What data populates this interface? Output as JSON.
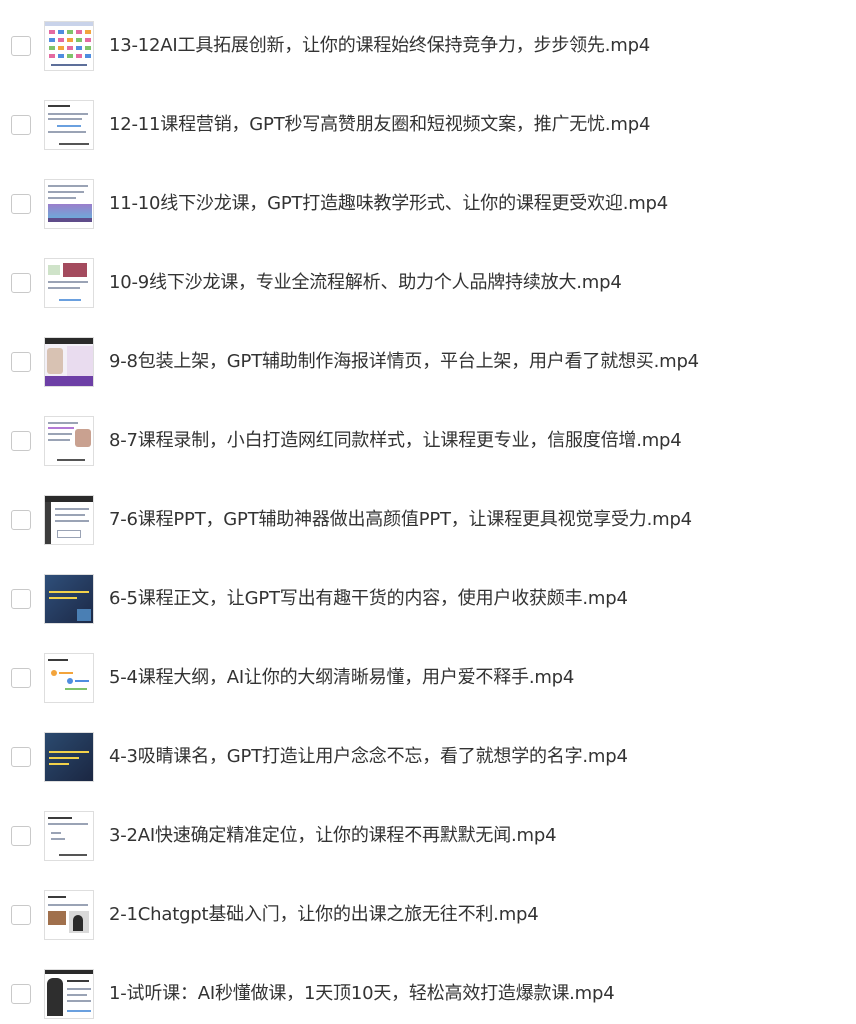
{
  "files": [
    {
      "name": "13-12AI工具拓展创新，让你的课程始终保持竞争力，步步领先.mp4",
      "thumb": "grid-icon-thumbnail"
    },
    {
      "name": "12-11课程营销，GPT秒写高赞朋友圈和短视频文案，推广无忧.mp4",
      "thumb": "doc-thumbnail"
    },
    {
      "name": "11-10线下沙龙课，GPT打造趣味教学形式、让你的课程更受欢迎.mp4",
      "thumb": "doc-photo-thumbnail"
    },
    {
      "name": "10-9线下沙龙课，专业全流程解析、助力个人品牌持续放大.mp4",
      "thumb": "doc-photo-thumbnail"
    },
    {
      "name": "9-8包装上架，GPT辅助制作海报详情页，平台上架，用户看了就想买.mp4",
      "thumb": "presenter-thumbnail"
    },
    {
      "name": "8-7课程录制，小白打造网红同款样式，让课程更专业，信服度倍增.mp4",
      "thumb": "screen-thumbnail"
    },
    {
      "name": "7-6课程PPT，GPT辅助神器做出高颜值PPT，让课程更具视觉享受力.mp4",
      "thumb": "screen-thumbnail"
    },
    {
      "name": "6-5课程正文，让GPT写出有趣干货的内容，使用户收获颇丰.mp4",
      "thumb": "dark-slide-thumbnail"
    },
    {
      "name": "5-4课程大纲，AI让你的大纲清晰易懂，用户爱不释手.mp4",
      "thumb": "mindmap-thumbnail"
    },
    {
      "name": "4-3吸睛课名，GPT打造让用户念念不忘，看了就想学的名字.mp4",
      "thumb": "dark-slide-thumbnail"
    },
    {
      "name": "3-2AI快速确定精准定位，让你的课程不再默默无闻.mp4",
      "thumb": "doc-thumbnail"
    },
    {
      "name": "2-1Chatgpt基础入门，让你的出课之旅无往不利.mp4",
      "thumb": "doc-photo-thumbnail"
    },
    {
      "name": "1-试听课：AI秒懂做课，1天顶10天，轻松高效打造爆款课.mp4",
      "thumb": "presenter-thumbnail"
    }
  ]
}
